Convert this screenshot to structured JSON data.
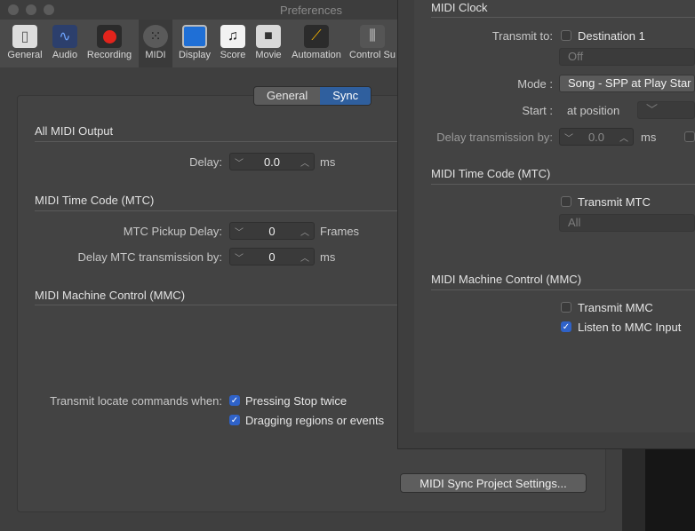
{
  "window": {
    "title": "Preferences"
  },
  "toolbar": {
    "items": [
      "General",
      "Audio",
      "Recording",
      "MIDI",
      "Display",
      "Score",
      "Movie",
      "Automation",
      "Control Su"
    ]
  },
  "tabs": {
    "general": "General",
    "sync": "Sync"
  },
  "all_midi_output": {
    "heading": "All MIDI Output",
    "delay_label": "Delay:",
    "delay_value": "0.0",
    "delay_unit": "ms"
  },
  "mtc": {
    "heading": "MIDI Time Code (MTC)",
    "pickup_label": "MTC Pickup Delay:",
    "pickup_value": "0",
    "pickup_unit": "Frames",
    "transmission_label": "Delay MTC transmission by:",
    "transmission_value": "0",
    "transmission_unit": "ms"
  },
  "mmc": {
    "heading": "MIDI Machine Control (MMC)",
    "locate_label": "Transmit locate commands when:",
    "stop_twice": "Pressing Stop twice",
    "dragging": "Dragging regions or events"
  },
  "project_settings_button": "MIDI Sync Project Settings...",
  "popup": {
    "clock": {
      "heading": "MIDI Clock",
      "transmit_label": "Transmit to:",
      "destination": "Destination 1",
      "off": "Off",
      "mode_label": "Mode :",
      "mode_value": "Song - SPP at Play Star",
      "start_label": "Start :",
      "start_value": "at position",
      "delay_label": "Delay transmission by:",
      "delay_value": "0.0",
      "delay_unit": "ms"
    },
    "mtc": {
      "heading": "MIDI Time Code (MTC)",
      "transmit": "Transmit MTC",
      "all": "All"
    },
    "mmc": {
      "heading": "MIDI Machine Control (MMC)",
      "transmit": "Transmit MMC",
      "listen": "Listen to MMC Input"
    }
  }
}
